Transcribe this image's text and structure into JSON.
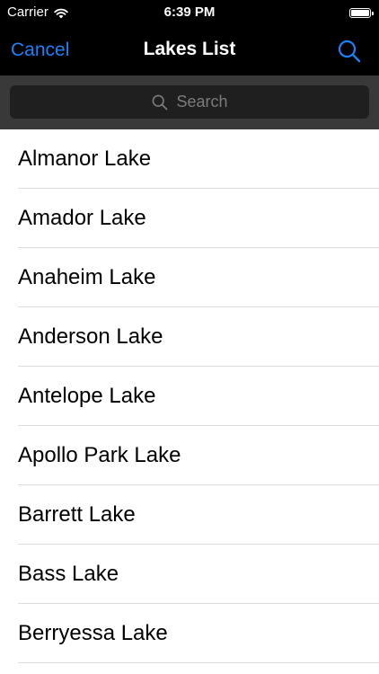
{
  "status_bar": {
    "carrier": "Carrier",
    "time": "6:39 PM"
  },
  "nav": {
    "cancel_label": "Cancel",
    "title": "Lakes List",
    "search_icon": "search-icon"
  },
  "search": {
    "placeholder": "Search"
  },
  "lakes": [
    "Almanor Lake",
    "Amador Lake",
    "Anaheim Lake",
    "Anderson Lake",
    "Antelope Lake",
    "Apollo Park Lake",
    "Barrett Lake",
    "Bass Lake",
    "Berryessa Lake"
  ],
  "colors": {
    "accent": "#1a82f7",
    "bar_background": "#000000",
    "search_background": "#393939"
  }
}
